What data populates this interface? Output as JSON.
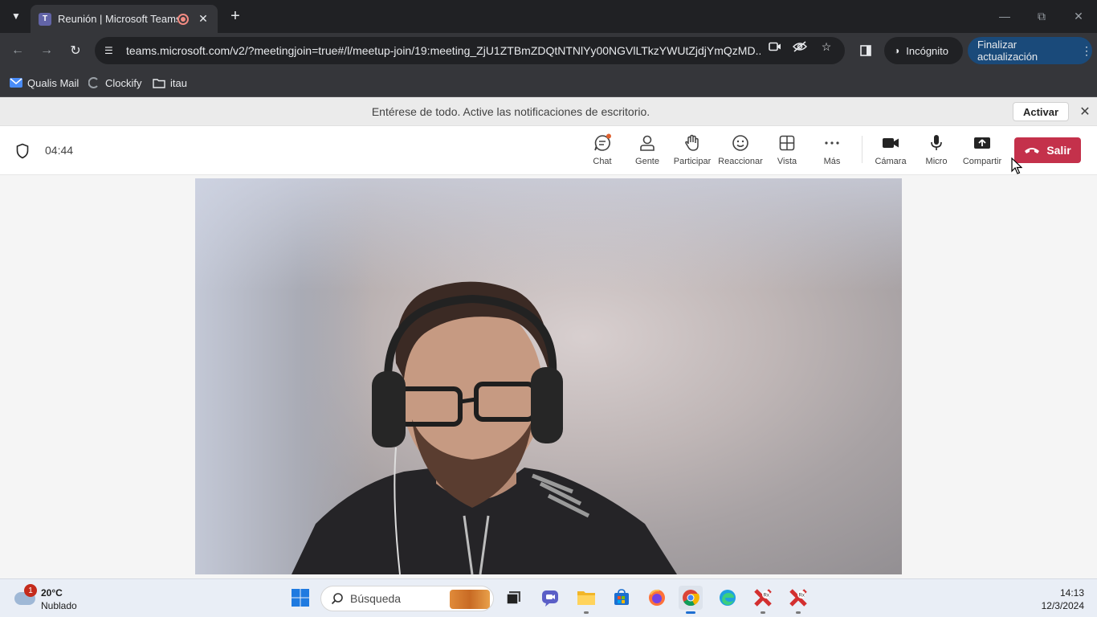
{
  "browser": {
    "tab_title": "Reunión | Microsoft Teams",
    "tab_logo_letter": "T",
    "url": "teams.microsoft.com/v2/?meetingjoin=true#/l/meetup-join/19:meeting_ZjU1ZTBmZDQtNTNlYy00NGVlLTkzYWUtZjdjYmQzMD...",
    "incognito_label": "Incógnito",
    "update_label": "Finalizar actualización",
    "bookmarks": [
      {
        "label": "Qualis Mail",
        "icon": "mail-icon"
      },
      {
        "label": "Clockify",
        "icon": "clockify-icon"
      },
      {
        "label": "itau",
        "icon": "folder-icon"
      }
    ]
  },
  "notification": {
    "text": "Entérese de todo. Active las notificaciones de escritorio.",
    "button": "Activar"
  },
  "meeting": {
    "timer": "04:44",
    "controls": [
      {
        "label": "Chat",
        "icon": "chat-icon"
      },
      {
        "label": "Gente",
        "icon": "people-icon"
      },
      {
        "label": "Participar",
        "icon": "raise-hand-icon"
      },
      {
        "label": "Reaccionar",
        "icon": "emoji-icon"
      },
      {
        "label": "Vista",
        "icon": "grid-view-icon"
      },
      {
        "label": "Más",
        "icon": "more-icon"
      },
      {
        "label": "Cámara",
        "icon": "camera-icon"
      },
      {
        "label": "Micro",
        "icon": "microphone-icon"
      },
      {
        "label": "Compartir",
        "icon": "share-icon"
      }
    ],
    "leave_label": "Salir",
    "accent_color": "#c4314b"
  },
  "taskbar": {
    "weather_badge": "1",
    "temperature": "20°C",
    "condition": "Nublado",
    "search_placeholder": "Búsqueda",
    "time": "14:13",
    "date": "12/3/2024"
  }
}
